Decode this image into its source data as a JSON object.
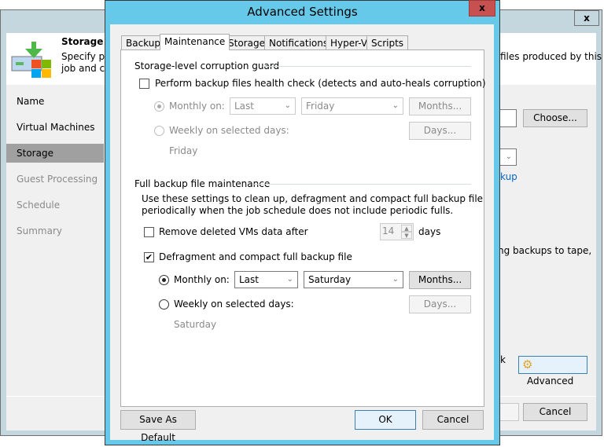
{
  "wizard": {
    "close": "x",
    "header_title": "Storage",
    "header_desc_1": "Specify pr",
    "header_desc_2": "job and cu",
    "header_desc_right": "files produced by this",
    "nav": [
      "Name",
      "Virtual Machines",
      "Storage",
      "Guest Processing",
      "Schedule",
      "Summary"
    ],
    "choose_button": "Choose...",
    "link_fragment": "kup",
    "tape_text": "ng backups to tape,",
    "k_text": "k",
    "advanced_button": "Advanced",
    "cancel_button": "Cancel"
  },
  "dialog": {
    "title": "Advanced Settings",
    "close": "x",
    "tabs": [
      "Backup",
      "Maintenance",
      "Storage",
      "Notifications",
      "Hyper-V",
      "Scripts"
    ],
    "corruption": {
      "heading": "Storage-level corruption guard",
      "health_check_label": "Perform backup files health check (detects and auto-heals corruption)",
      "health_checked": false,
      "monthly_label": "Monthly on:",
      "monthly_week": "Last",
      "monthly_day": "Friday",
      "months_button": "Months...",
      "weekly_label": "Weekly on selected days:",
      "days_button": "Days...",
      "weekly_days": "Friday"
    },
    "full": {
      "heading": "Full backup file maintenance",
      "desc_1": "Use these settings to clean up, defragment and compact full backup file",
      "desc_2": "periodically when the job schedule does not include periodic fulls.",
      "remove_label": "Remove deleted VMs data after",
      "remove_checked": false,
      "remove_days": "14",
      "days_unit": "days",
      "defrag_label": "Defragment and compact full backup file",
      "defrag_checked": true,
      "monthly_label": "Monthly on:",
      "monthly_week": "Last",
      "monthly_day": "Saturday",
      "months_button": "Months...",
      "weekly_label": "Weekly on selected days:",
      "days_button": "Days...",
      "weekly_days": "Saturday"
    },
    "save_default_button": "Save As Default",
    "ok_button": "OK",
    "cancel_button": "Cancel"
  }
}
